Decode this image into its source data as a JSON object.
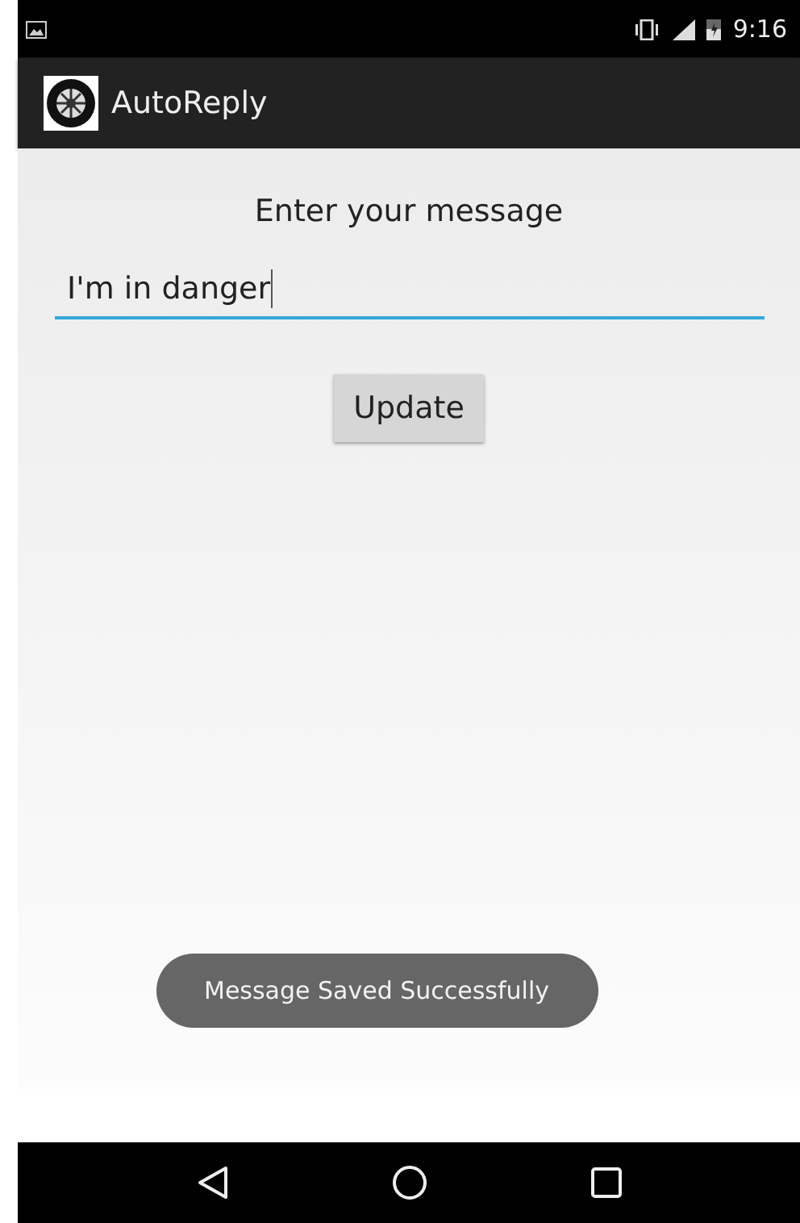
{
  "status_bar": {
    "time": "9:16"
  },
  "app_bar": {
    "title": "AutoReply"
  },
  "form": {
    "label": "Enter your message",
    "field": {
      "value": "I'm in danger",
      "focused": true
    },
    "button": "Update"
  },
  "toast": {
    "text": "Message Saved Successfully"
  }
}
